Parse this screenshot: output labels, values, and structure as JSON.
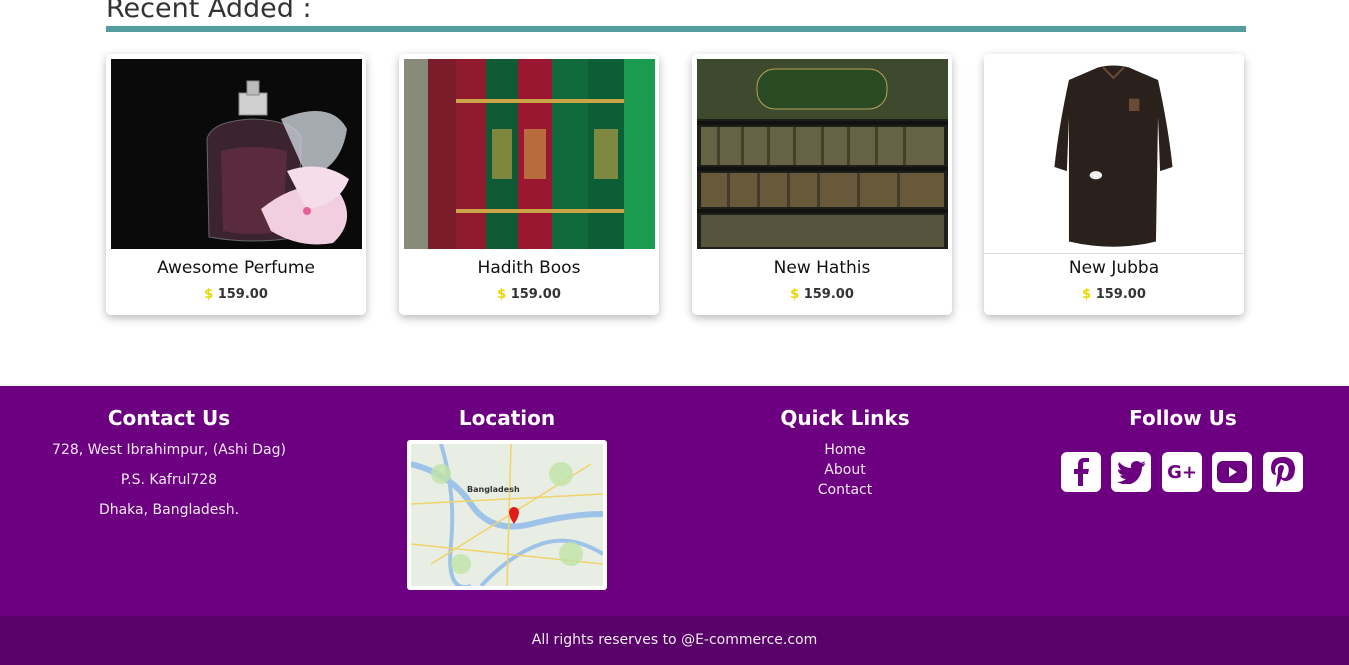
{
  "section": {
    "title": "Recent Added :"
  },
  "products": [
    {
      "name": "Awesome Perfume",
      "currency": "$",
      "price": "159.00"
    },
    {
      "name": "Hadith Boos",
      "currency": "$",
      "price": "159.00"
    },
    {
      "name": "New Hathis",
      "currency": "$",
      "price": "159.00"
    },
    {
      "name": "New Jubba",
      "currency": "$",
      "price": "159.00"
    }
  ],
  "footer": {
    "contact": {
      "title": "Contact Us",
      "line1": "728, West Ibrahimpur, (Ashi Dag)",
      "line2": "P.S. Kafrul728",
      "line3": "Dhaka, Bangladesh."
    },
    "location": {
      "title": "Location",
      "map_label": "Bangladesh"
    },
    "quick_links": {
      "title": "Quick Links",
      "items": [
        "Home",
        "About",
        "Contact"
      ]
    },
    "follow": {
      "title": "Follow Us",
      "icons": [
        "facebook-icon",
        "twitter-icon",
        "google-plus-icon",
        "youtube-icon",
        "pinterest-icon"
      ]
    },
    "copyright": "All rights reserves to @E-commerce.com"
  },
  "colors": {
    "accent_bar": "#559c9e",
    "footer_bg": "#6c0080",
    "footer_bottom_bg": "#5a006b",
    "currency": "#e6d800"
  }
}
